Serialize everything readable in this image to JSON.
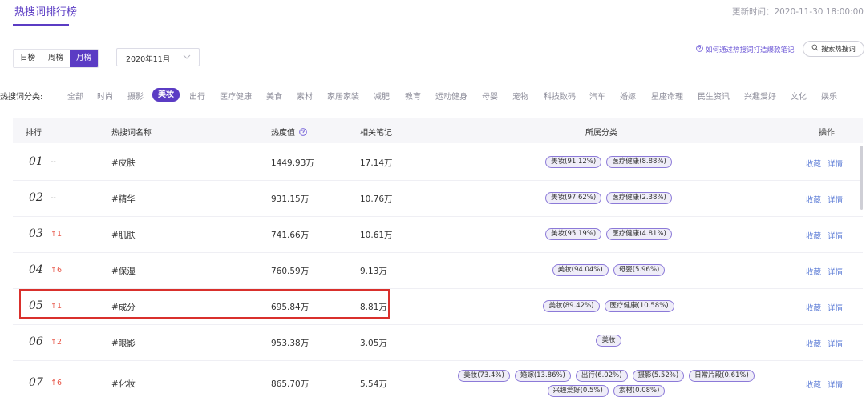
{
  "header": {
    "title": "热搜词排行榜",
    "update_time": "更新时间：2020-11-30 18:00:00"
  },
  "toolbar": {
    "periods": [
      "日榜",
      "周榜",
      "月榜"
    ],
    "active_period": "月榜",
    "month_value": "2020年11月",
    "howto_link": "如何通过热搜词打造爆款笔记",
    "search_button": "搜索热搜词"
  },
  "categories": {
    "label": "热搜词分类:",
    "items": [
      "全部",
      "时尚",
      "摄影",
      "美妆",
      "出行",
      "医疗健康",
      "美食",
      "素材",
      "家居家装",
      "减肥",
      "教育",
      "运动健身",
      "母婴",
      "宠物",
      "科技数码",
      "汽车",
      "婚嫁",
      "星座命理",
      "民生资讯",
      "兴趣爱好",
      "文化",
      "娱乐"
    ],
    "active": "美妆"
  },
  "table": {
    "headers": {
      "rank": "排行",
      "keyword": "热搜词名称",
      "heat": "热度值",
      "notes": "相关笔记",
      "category": "所属分类",
      "ops": "操作"
    },
    "rows": [
      {
        "rank": "01",
        "trend": "--",
        "keyword": "#皮肤",
        "heat": "1449.93万",
        "notes": "17.14万",
        "tags": [
          "美妆(91.12%)",
          "医疗健康(8.88%)"
        ],
        "fav": "收藏",
        "detail": "详情"
      },
      {
        "rank": "02",
        "trend": "--",
        "keyword": "#精华",
        "heat": "931.15万",
        "notes": "10.76万",
        "tags": [
          "美妆(97.62%)",
          "医疗健康(2.38%)"
        ],
        "fav": "收藏",
        "detail": "详情"
      },
      {
        "rank": "03",
        "trend": "↑1",
        "keyword": "#肌肤",
        "heat": "741.66万",
        "notes": "10.61万",
        "tags": [
          "美妆(95.19%)",
          "医疗健康(4.81%)"
        ],
        "fav": "收藏",
        "detail": "详情"
      },
      {
        "rank": "04",
        "trend": "↑6",
        "keyword": "#保湿",
        "heat": "760.59万",
        "notes": "9.13万",
        "tags": [
          "美妆(94.04%)",
          "母婴(5.96%)"
        ],
        "fav": "收藏",
        "detail": "详情"
      },
      {
        "rank": "05",
        "trend": "↑1",
        "keyword": "#成分",
        "heat": "695.84万",
        "notes": "8.81万",
        "tags": [
          "美妆(89.42%)",
          "医疗健康(10.58%)"
        ],
        "fav": "收藏",
        "detail": "详情"
      },
      {
        "rank": "06",
        "trend": "↑2",
        "keyword": "#眼影",
        "heat": "953.38万",
        "notes": "3.05万",
        "tags": [
          "美妆"
        ],
        "fav": "收藏",
        "detail": "详情"
      },
      {
        "rank": "07",
        "trend": "↑6",
        "keyword": "#化妆",
        "heat": "865.70万",
        "notes": "5.54万",
        "tags": [
          "美妆(73.4%)",
          "婚嫁(13.86%)",
          "出行(6.02%)",
          "摄影(5.52%)",
          "日常片段(0.61%)",
          "兴趣爱好(0.5%)",
          "素材(0.08%)"
        ],
        "fav": "收藏",
        "detail": "详情"
      }
    ]
  },
  "colors": {
    "brand": "#5b3cc4",
    "trend_up": "#e8584a",
    "link": "#5b7bd6",
    "highlight": "#d9302c"
  }
}
